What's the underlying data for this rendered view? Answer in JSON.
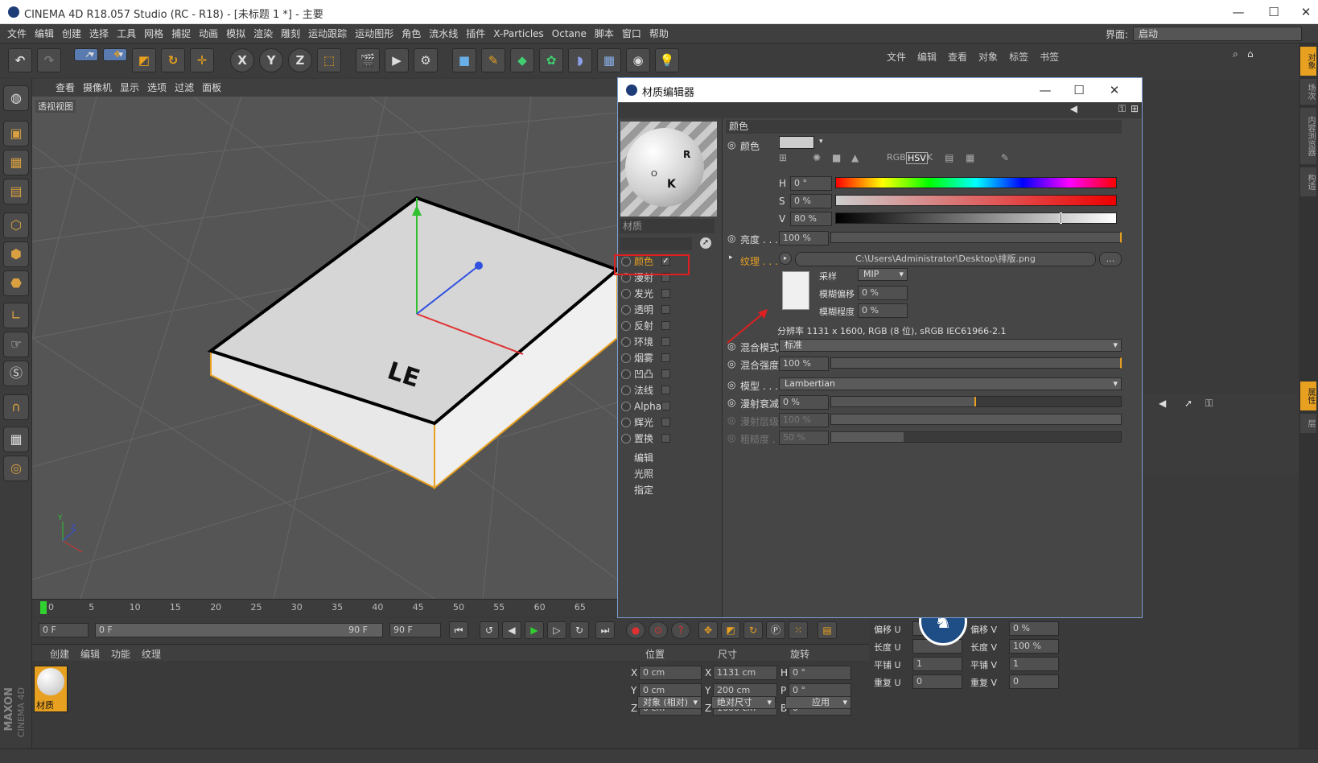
{
  "app": {
    "title": "CINEMA 4D R18.057 Studio (RC - R18) - [未标题 1 *] - 主要",
    "window_controls": {
      "minimize": "—",
      "maximize": "☐",
      "close": "✕"
    }
  },
  "menubar": {
    "items": [
      "文件",
      "编辑",
      "创建",
      "选择",
      "工具",
      "网格",
      "捕捉",
      "动画",
      "模拟",
      "渲染",
      "雕刻",
      "运动跟踪",
      "运动图形",
      "角色",
      "流水线",
      "插件",
      "X-Particles",
      "Octane",
      "脚本",
      "窗口",
      "帮助"
    ],
    "layout_label": "界面:",
    "layout_value": "启动"
  },
  "toolbar": {
    "buttons": [
      "undo",
      "redo",
      "select",
      "move",
      "scale",
      "rotate",
      "move-plus",
      "X",
      "Y",
      "Z",
      "coords",
      "render-view",
      "render",
      "render-settings",
      "cube",
      "pen",
      "subdivide",
      "cloner",
      "deformer",
      "floor",
      "camera",
      "light"
    ]
  },
  "viewport": {
    "menu": [
      "查看",
      "摄像机",
      "显示",
      "选项",
      "过滤",
      "面板"
    ],
    "label": "透视视图",
    "box_front_text": "LE",
    "axis_label_y": "Y",
    "axis_label_z": "Z"
  },
  "timeline": {
    "ticks": [
      "0",
      "5",
      "10",
      "15",
      "20",
      "25",
      "30",
      "35",
      "40",
      "45",
      "50",
      "55",
      "60",
      "65"
    ]
  },
  "playbar": {
    "current_frame": "0 F",
    "range_start": "0 F",
    "range_end": "90 F",
    "max_frame": "90 F"
  },
  "material_manager": {
    "menu": [
      "创建",
      "编辑",
      "功能",
      "纹理"
    ],
    "material_label": "材质"
  },
  "coordinates": {
    "headers": [
      "位置",
      "尺寸",
      "旋转"
    ],
    "rows": [
      {
        "axis": "X",
        "pos": "0 cm",
        "size_axis": "X",
        "size": "1131 cm",
        "rot_axis": "H",
        "rot": "0 °"
      },
      {
        "axis": "Y",
        "pos": "0 cm",
        "size_axis": "Y",
        "size": "200 cm",
        "rot_axis": "P",
        "rot": "0 °"
      },
      {
        "axis": "Z",
        "pos": "0 cm",
        "size_axis": "Z",
        "size": "1600 cm",
        "rot_axis": "B",
        "rot": "0 °"
      }
    ],
    "mode": "对象 (相对)",
    "size_mode": "绝对尺寸",
    "apply": "应用"
  },
  "object_manager": {
    "menu": [
      "文件",
      "编辑",
      "查看",
      "对象",
      "标签",
      "书签"
    ]
  },
  "texture_props": {
    "rows": [
      {
        "l_label": "偏移 U",
        "l_value": "",
        "r_label": "偏移 V",
        "r_value": "0 %"
      },
      {
        "l_label": "长度 U",
        "l_value": "",
        "r_label": "长度 V",
        "r_value": "100 %"
      },
      {
        "l_label": "平铺 U",
        "l_value": "1",
        "r_label": "平铺 V",
        "r_value": "1"
      },
      {
        "l_label": "重复 U",
        "l_value": "0",
        "r_label": "重复 V",
        "r_value": "0"
      }
    ]
  },
  "right_strip": [
    "对象",
    "场次",
    "内容浏览器",
    "构造",
    "属性",
    "层"
  ],
  "material_editor": {
    "title": "材质编辑器",
    "material_name": "材质",
    "channels": [
      {
        "label": "颜色",
        "checked": true,
        "active": true
      },
      {
        "label": "漫射",
        "checked": false
      },
      {
        "label": "发光",
        "checked": false
      },
      {
        "label": "透明",
        "checked": false
      },
      {
        "label": "反射",
        "checked": false
      },
      {
        "label": "环境",
        "checked": false
      },
      {
        "label": "烟雾",
        "checked": false
      },
      {
        "label": "凹凸",
        "checked": false
      },
      {
        "label": "法线",
        "checked": false
      },
      {
        "label": "Alpha",
        "checked": false
      },
      {
        "label": "辉光",
        "checked": false
      },
      {
        "label": "置换",
        "checked": false
      }
    ],
    "extra": [
      "编辑",
      "光照",
      "指定"
    ],
    "section_color": "颜色",
    "color_label": "颜色",
    "color_mode_buttons": [
      "RGB",
      "HSV",
      "K"
    ],
    "h_label": "H",
    "h_value": "0 °",
    "s_label": "S",
    "s_value": "0 %",
    "v_label": "V",
    "v_value": "80 %",
    "v_fill": 0.8,
    "brightness_label": "亮度 . . .",
    "brightness_value": "100 %",
    "texture_label": "纹理 . . .",
    "texture_path": "C:\\Users\\Administrator\\Desktop\\排版.png",
    "texture_more": "...",
    "sampling_label": "采样",
    "sampling_value": "MIP",
    "blur_offset_label": "模糊偏移",
    "blur_offset_value": "0 %",
    "blur_scale_label": "模糊程度",
    "blur_scale_value": "0 %",
    "resolution": "分辨率 1131 x 1600, RGB (8 位), sRGB IEC61966-2.1",
    "mix_mode_label": "混合模式",
    "mix_mode_value": "标准",
    "mix_strength_label": "混合强度",
    "mix_strength_value": "100 %",
    "model_label": "模型 . . .",
    "model_value": "Lambertian",
    "diffuse_falloff_label": "漫射衰减",
    "diffuse_falloff_value": "0 %",
    "diffuse_falloff_fill": 0.5,
    "diffuse_level_label": "漫射层级",
    "diffuse_level_value": "100 %",
    "roughness_label": "粗糙度 . .",
    "roughness_value": "50 %",
    "roughness_fill": 0.25
  },
  "colors": {
    "accent": "#e8a020",
    "selection": "#5a7bb0",
    "highlight_box": "#e02020"
  }
}
